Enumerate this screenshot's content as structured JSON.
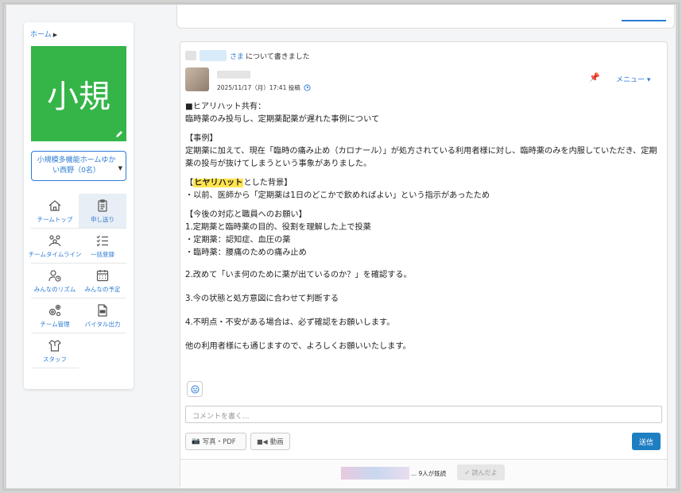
{
  "sidebar": {
    "breadcrumb": "ホーム",
    "team_tile": "小規",
    "team_select": "小規模多機能ホームゆかい西野（0名）",
    "nav": [
      {
        "label": "チームトップ",
        "icon": "home-icon"
      },
      {
        "label": "申し送り",
        "icon": "clipboard-icon",
        "active": true
      },
      {
        "label": "チームタイムライン",
        "icon": "team-timeline-icon"
      },
      {
        "label": "一括登録",
        "icon": "checklist-icon"
      },
      {
        "label": "みんなのリズム",
        "icon": "user-clock-icon"
      },
      {
        "label": "みんなの予定",
        "icon": "calendar-icon"
      },
      {
        "label": "チーム管理",
        "icon": "gears-icon"
      },
      {
        "label": "バイタル出力",
        "icon": "csv-file-icon"
      },
      {
        "label": "スタッフ",
        "icon": "staff-icon"
      }
    ]
  },
  "post": {
    "recipient_suffix": "さま",
    "wrote_about": "について書きました",
    "date": "2025/11/17（月）17:41 投稿",
    "menu_label": "メニュー ▾",
    "body": {
      "p1a": "■ヒアリハット共有：",
      "p1b": "臨時薬のみ投与し、定期薬配薬が遅れた事例について",
      "p2a": "【事例】",
      "p2b": "定期薬に加えて、現在「臨時の痛み止め（カロナール）」が処方されている利用者様に対し、臨時薬のみを内服していただき、定期薬の投与が抜けてしまうという事象がありました。",
      "p3_open": "【",
      "p3_hl": "ヒヤリハット",
      "p3_close": "とした背景】",
      "p3b": "・以前、医師から「定期薬は1日のどこかで飲めればよい」という指示があったため",
      "p4a": "【今後の対応と職員へのお願い】",
      "p4b": "1.定期薬と臨時薬の目的、役割を理解した上で投薬",
      "p4c": "・定期薬：認知症、血圧の薬",
      "p4d": "・臨時薬：腰痛のための痛み止め",
      "p5": "2.改めて「いま何のために薬が出ているのか？」を確認する。",
      "p6": "3.今の状態と処方意図に合わせて判断する",
      "p7": "4.不明点・不安がある場合は、必ず確認をお願いします。",
      "p8": "他の利用者様にも通じますので、よろしくお願いいたします。"
    },
    "comment_placeholder": "コメントを書く...",
    "photo_button": "写真・PDF",
    "video_button": "動画",
    "send_button": "送信",
    "readers_text": "... 9人が既読",
    "read_button": "✓ 読んだよ"
  },
  "colors": {
    "accent": "#2b7bd6",
    "team_tile": "#35b548",
    "send": "#1e7ec2",
    "highlight": "#ffe44c"
  }
}
